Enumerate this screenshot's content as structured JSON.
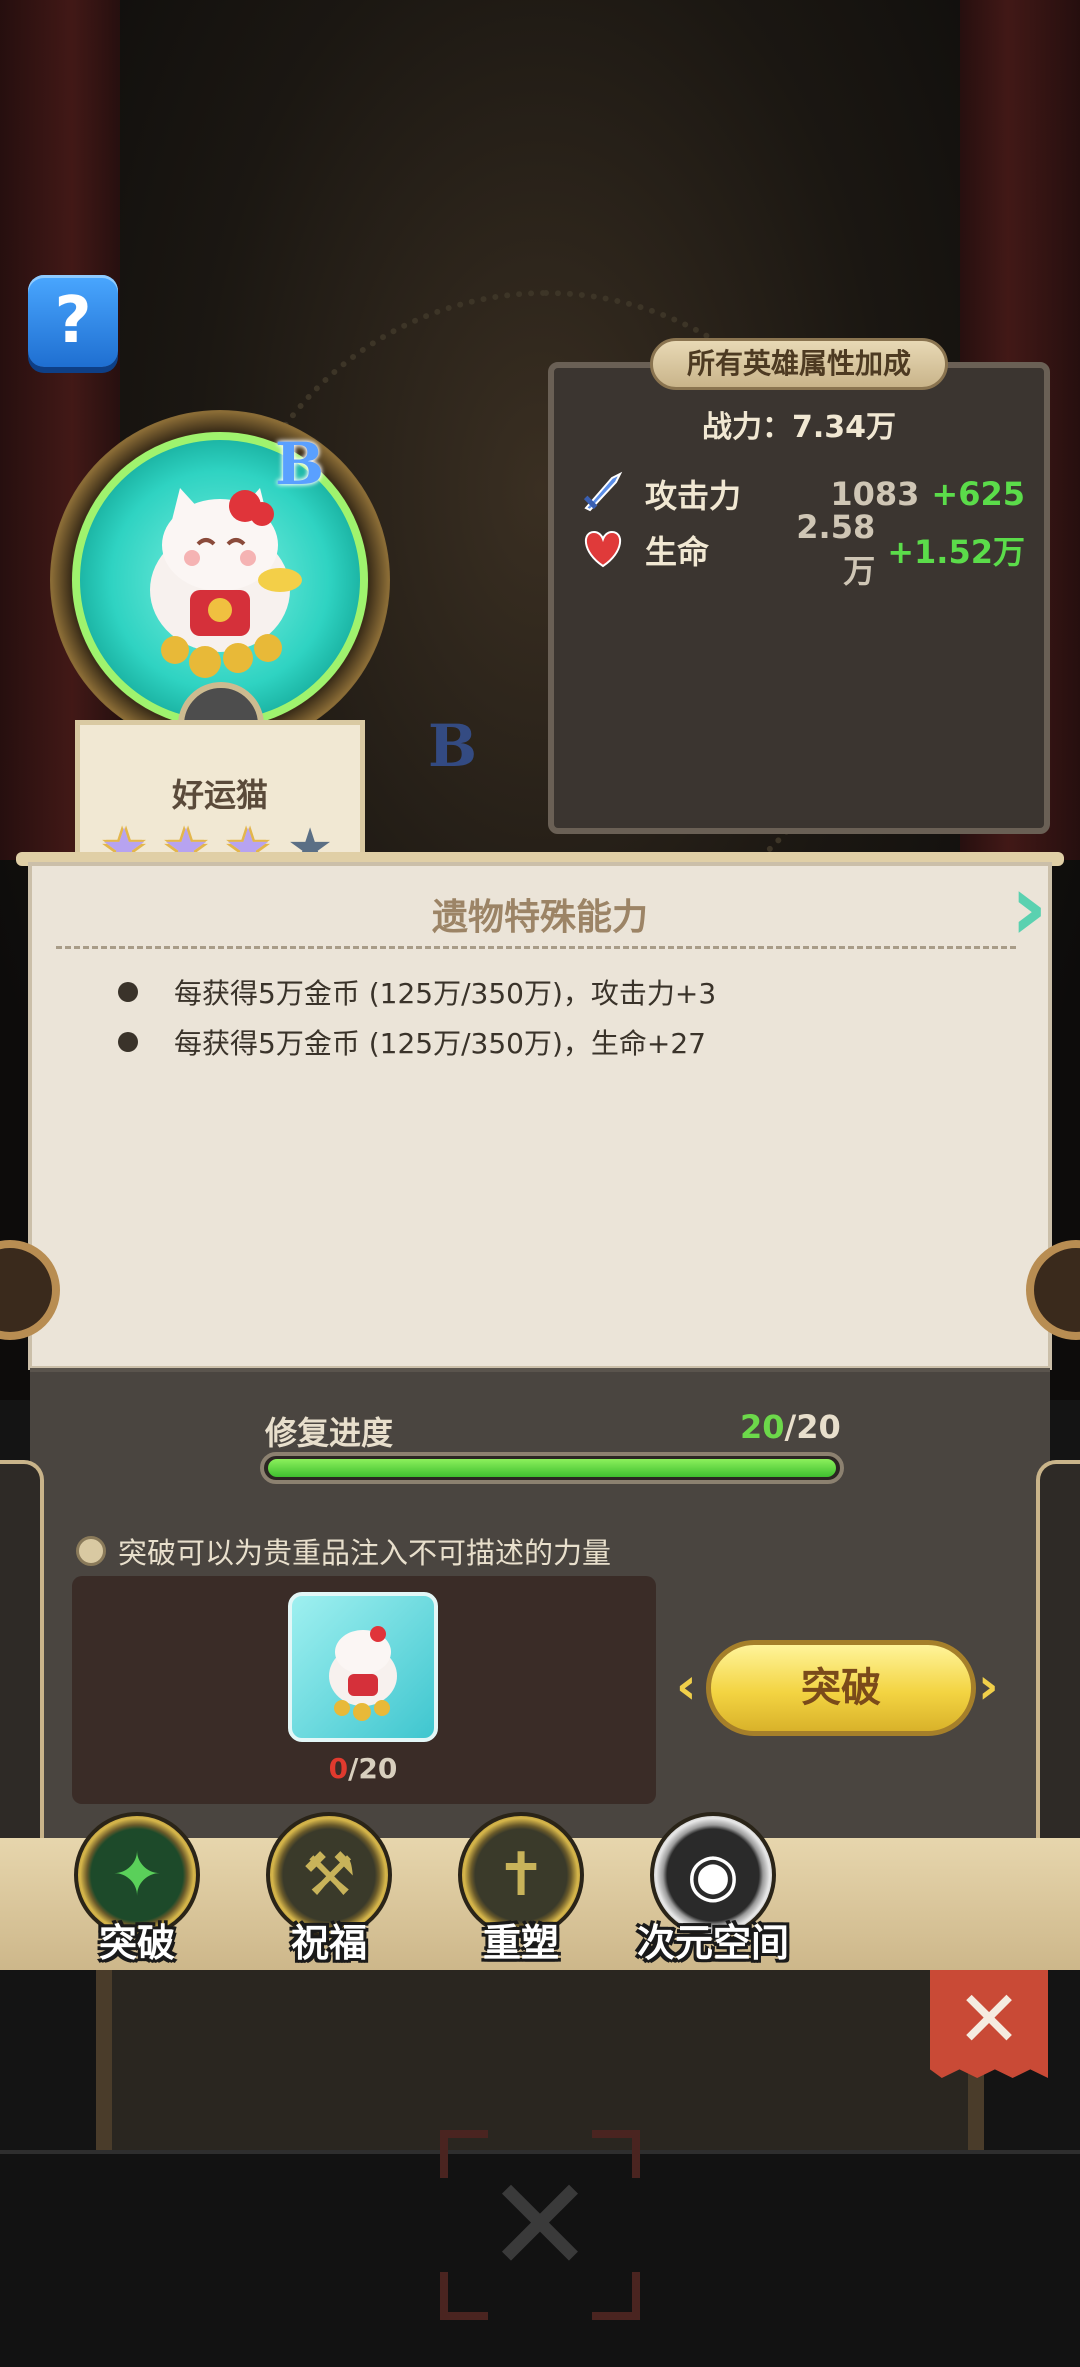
{
  "help": {
    "label": "?"
  },
  "hero": {
    "name": "好运猫",
    "grade": "B",
    "stars_filled": 3,
    "stars_total": 4
  },
  "attributes": {
    "title": "所有英雄属性加成",
    "power_line": "战力：7.34万",
    "stats": [
      {
        "icon": "sword-icon",
        "name": "攻击力",
        "value": "1083",
        "bonus": "+625"
      },
      {
        "icon": "heart-icon",
        "name": "生命",
        "value": "2.58万",
        "bonus": "+1.52万"
      }
    ]
  },
  "relic": {
    "title": "遗物特殊能力",
    "abilities": [
      "每获得5万金币 (125万/350万)，攻击力+3",
      "每获得5万金币 (125万/350万)，生命+27"
    ]
  },
  "repair": {
    "label": "修复进度",
    "current": "20",
    "separator": "/",
    "total": "20",
    "progress": 1.0
  },
  "breakthrough": {
    "hint": "突破可以为贵重品注入不可描述的力量",
    "material_have": "0",
    "material_sep": "/",
    "material_need": "20",
    "button_label": "突破"
  },
  "tabs": [
    {
      "label": "突破",
      "icon": "claw-icon",
      "active": true
    },
    {
      "label": "祝福",
      "icon": "hammer-icon",
      "active": false
    },
    {
      "label": "重塑",
      "icon": "reshape-icon",
      "active": false
    },
    {
      "label": "次元空间",
      "icon": "planet-icon",
      "active": false
    }
  ],
  "colors": {
    "accent_green": "#5bdc4a",
    "warning_red": "#e03a2e",
    "button_yellow": "#f3d442",
    "close_red": "#c94a36"
  }
}
